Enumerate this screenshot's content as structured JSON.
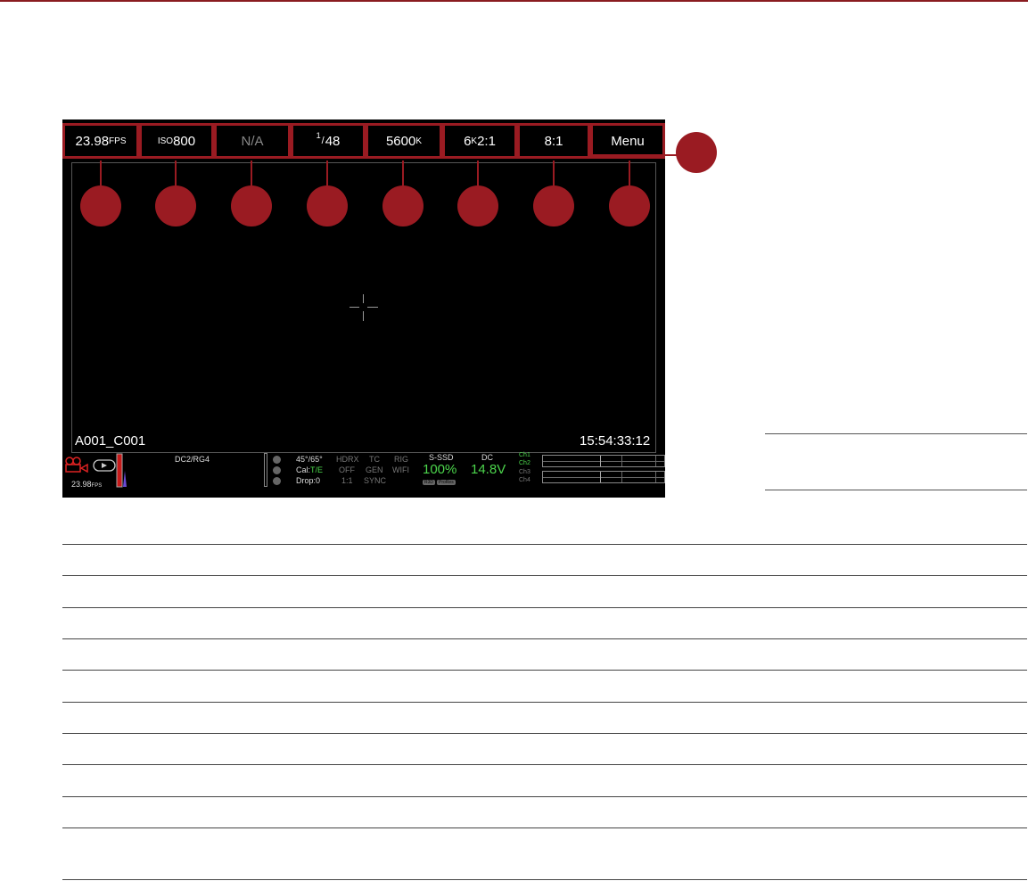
{
  "colors": {
    "accent": "#9a1b22",
    "ok_green": "#4cd64c",
    "screen_bg": "#000000"
  },
  "topbar": {
    "fps": {
      "value": "23.98",
      "unit": "FPS"
    },
    "iso": {
      "prefix": "ISO",
      "value": "800"
    },
    "aperture": "N/A",
    "shutter": {
      "numerator": "1",
      "value": "48"
    },
    "white_balance": {
      "value": "5600",
      "unit": "K"
    },
    "format": {
      "value": "6",
      "unit": "K",
      "ratio": " 2:1"
    },
    "compression": "8:1",
    "menu": "Menu"
  },
  "viewfinder": {
    "clip_name": "A001_C001",
    "timecode": "15:54:33:12"
  },
  "status_bar": {
    "record_fps": {
      "value": "23.98",
      "unit": "FPS"
    },
    "look": "DC2/RG4",
    "shutter_angle": "45°/65°",
    "cal_label": "Cal:",
    "cal_value": "T/E",
    "drop": "Drop:0",
    "hdrx": "HDRX",
    "hdrx_value": "OFF",
    "hdrx_ratio": "1:1",
    "tc": "TC",
    "tc_value": "GEN",
    "tc_sync": "SYNC",
    "rig": "RIG",
    "rig_value": "WIFI",
    "media_label": "S-SSD",
    "media_value": "100%",
    "media_tags": [
      "R3D",
      "ProRes"
    ],
    "power_label": "DC",
    "power_value": "14.8V",
    "audio_channels": [
      "Ch1",
      "Ch2",
      "Ch3",
      "Ch4"
    ]
  },
  "icons": [
    "record-camera-icon",
    "playback-icon",
    "histogram-icon",
    "status-dot-icon"
  ]
}
